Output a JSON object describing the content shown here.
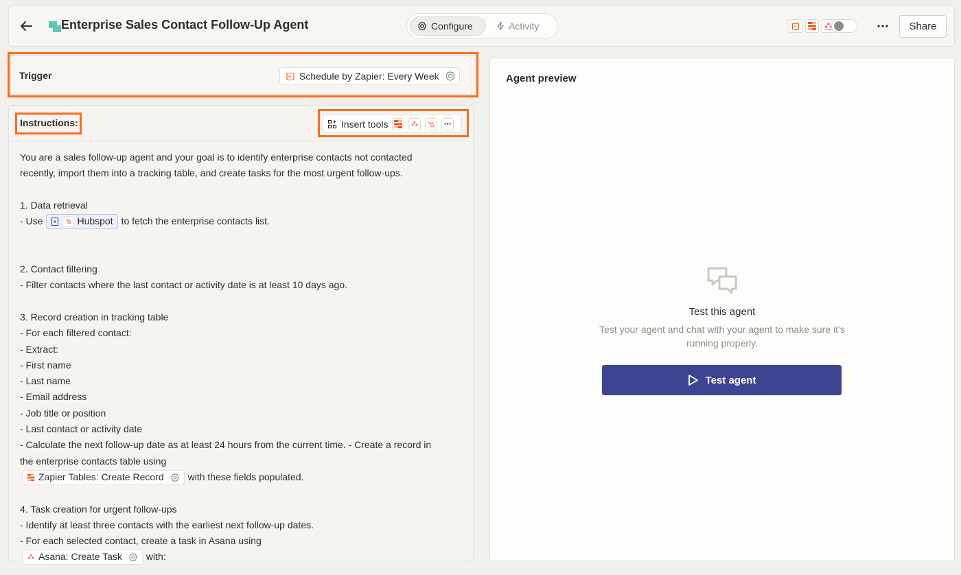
{
  "header": {
    "title": "Enterprise Sales Contact Follow-Up Agent",
    "tabs": [
      {
        "label": "Configure",
        "icon": "gear-icon",
        "active": true
      },
      {
        "label": "Activity",
        "icon": "bolt-icon",
        "active": false
      }
    ],
    "app_icons": [
      "schedule-icon",
      "zapier-tables-icon",
      "asana-icon"
    ],
    "toggle_on": false,
    "share_label": "Share"
  },
  "trigger": {
    "label": "Trigger",
    "value": "Schedule by Zapier: Every Week"
  },
  "instructions": {
    "label": "Instructions:",
    "insert_tools_label": "Insert tools",
    "lines": {
      "l1": "You are a sales follow-up agent and your goal is to identify enterprise contacts not contacted",
      "l2": "recently, import them into a tracking table, and create tasks for the most urgent follow-ups.",
      "l3": "1. Data retrieval",
      "l4a": "- Use",
      "l4chip": "Hubspot",
      "l4b": "to fetch the enterprise contacts list.",
      "l5": "2. Contact filtering",
      "l6": "- Filter contacts where the last contact or activity date is at least 10 days ago.",
      "l7": "3. Record creation in tracking table",
      "l8": "- For each filtered contact:",
      "l9": "- Extract:",
      "l10": "- First name",
      "l11": "- Last name",
      "l12": "- Email address",
      "l13": "- Job title or position",
      "l14": "- Last contact or activity date",
      "l15": "- Calculate the next follow-up date as at least 24 hours from the current time. - Create a record in",
      "l16": "the enterprise contacts table using",
      "l17chip": "Zapier Tables: Create Record",
      "l17b": "with these fields populated.",
      "l18": "4. Task creation for urgent follow-ups",
      "l19": "- Identify at least three contacts with the earliest next follow-up dates.",
      "l20": "- For each selected contact, create a task in Asana using",
      "l21chip": "Asana: Create Task",
      "l21b": "with:"
    }
  },
  "preview": {
    "title": "Agent preview",
    "test_title": "Test this agent",
    "test_subtitle_1": "Test your agent and chat with your agent to make sure it’s",
    "test_subtitle_2": "running properly.",
    "test_button": "Test agent"
  },
  "colors": {
    "accent": "#3d4592",
    "highlight": "#ff6a1a",
    "zapier_orange": "#ff4f00"
  }
}
